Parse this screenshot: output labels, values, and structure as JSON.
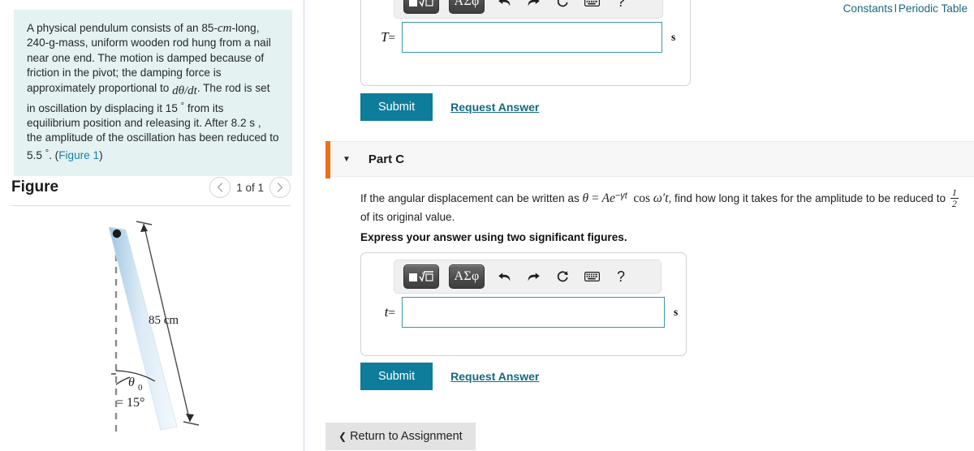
{
  "problem": {
    "segments": [
      "A physical pendulum consists of an 85-",
      "cm",
      "-long, 240-g-mass, uniform wooden rod hung from a nail near one end. The motion is damped because of friction in the pivot; the damping force is approximately proportional to ",
      "dθ/dt",
      ". The rod is set in oscillation by displacing it 15 ",
      "°",
      " from its equilibrium position and releasing it. After 8.2 s , the amplitude of the oscillation has been reduced to 5.5 ",
      "°",
      ". (",
      "Figure 1",
      ")"
    ],
    "text_part_1": "A physical pendulum consists of an 85-",
    "unit_cm": "cm",
    "text_part_2": "-long, 240-g-mass, uniform wooden rod hung from a nail near one end. The motion is damped because of friction in the pivot; the damping force is approximately proportional to ",
    "math_ddt_num": "dθ",
    "math_ddt_den": "dt",
    "text_part_3": ". The rod is set in oscillation by displacing it 15",
    "deg_1": "°",
    "text_part_4": " from its equilibrium position and releasing it. After 8.2 s , the amplitude of the oscillation has been reduced to 5.5",
    "deg_2": "°",
    "text_part_5": ". (",
    "figure_link": "Figure 1",
    "text_part_6": ")"
  },
  "figure": {
    "title": "Figure",
    "prev_icon": "chevron-left-icon",
    "next_icon": "chevron-right-icon",
    "counter": "1 of 1",
    "rod_label": "85 cm",
    "angle_label_theta": "θ",
    "angle_label_sub": "0",
    "angle_label_value": "= 15°"
  },
  "header": {
    "constants_label": "Constants",
    "separator": "l",
    "periodic_table_label": "Periodic Table"
  },
  "part_a": {
    "toolbar": [
      {
        "name": "template-math-button",
        "label": "□ⁿ√□"
      },
      {
        "name": "greek-symbols-button",
        "label": "ΑΣφ"
      },
      {
        "name": "undo-button",
        "label": "undo-icon"
      },
      {
        "name": "redo-button",
        "label": "redo-icon"
      },
      {
        "name": "reset-button",
        "label": "reset-icon"
      },
      {
        "name": "keyboard-button",
        "label": "keyboard-icon"
      },
      {
        "name": "help-button",
        "label": "?"
      }
    ],
    "field_label": "T",
    "field_equals": "=",
    "field_value": "",
    "field_placeholder": "",
    "unit": "s",
    "submit_label": "Submit",
    "request_answer_label": "Request Answer"
  },
  "part_c": {
    "caret_icon": "triangle-down-icon",
    "title": "Part C",
    "question_pre": "If the angular displacement can be written as ",
    "math_theta": "θ",
    "math_equals": "=",
    "math_A": "A",
    "math_e": "e",
    "math_exp": "−γt",
    "math_cos": "cos",
    "math_omega": "ω",
    "math_prime": "′",
    "math_t": "t",
    "question_mid": ", find how long it takes for the amplitude to be reduced to ",
    "frac_num": "1",
    "frac_den": "2",
    "question_post": " of its original value.",
    "instruction": "Express your answer using two significant figures.",
    "toolbar": [
      {
        "name": "template-math-button",
        "label": "□ⁿ√□"
      },
      {
        "name": "greek-symbols-button",
        "label": "ΑΣφ"
      },
      {
        "name": "undo-button",
        "label": "undo-icon"
      },
      {
        "name": "redo-button",
        "label": "redo-icon"
      },
      {
        "name": "reset-button",
        "label": "reset-icon"
      },
      {
        "name": "keyboard-button",
        "label": "keyboard-icon"
      },
      {
        "name": "help-button",
        "label": "?"
      }
    ],
    "greek_label": "ΑΣφ",
    "help_label": "?",
    "field_label": "t",
    "field_equals": "=",
    "field_value": "",
    "field_placeholder": "",
    "unit": "s",
    "submit_label": "Submit",
    "request_answer_label": "Request Answer"
  },
  "footer": {
    "return_chevron": "❮",
    "return_label": "Return to Assignment"
  },
  "colors": {
    "accent_teal": "#0e7c9b",
    "link_teal": "#17697f",
    "orange_bar": "#ec7014",
    "problem_bg": "#e4f2f1",
    "input_border": "#3f93ad"
  }
}
